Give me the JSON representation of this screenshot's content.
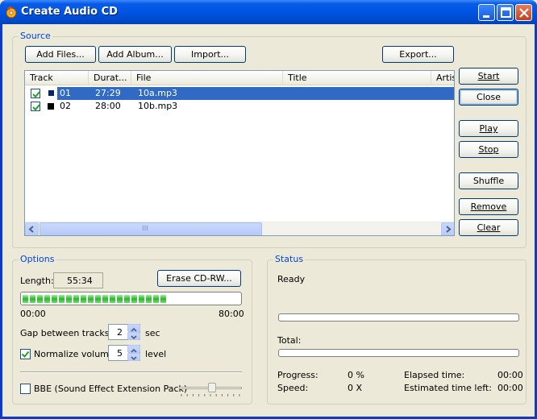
{
  "window": {
    "title": "Create Audio CD"
  },
  "source": {
    "group_label": "Source",
    "buttons": {
      "add_files": "Add Files...",
      "add_album": "Add Album...",
      "import": "Import...",
      "export": "Export..."
    },
    "columns": [
      "Track",
      "Durat...",
      "File",
      "Title",
      "Artis"
    ],
    "tracks": [
      {
        "checked": true,
        "track": "01",
        "duration": "27:29",
        "file": "10a.mp3",
        "selected": true
      },
      {
        "checked": true,
        "track": "02",
        "duration": "28:00",
        "file": "10b.mp3",
        "selected": false
      }
    ],
    "scroll_grip": "III"
  },
  "side_buttons": {
    "start": "Start",
    "close": "Close",
    "play": "Play",
    "stop": "Stop",
    "shuffle": "Shuffle",
    "remove": "Remove",
    "clear": "Clear"
  },
  "options": {
    "group_label": "Options",
    "length_label": "Length:",
    "length_value": "55:34",
    "erase_button": "Erase CD-RW...",
    "capacity_fill_fraction": 0.69,
    "scale_start": "00:00",
    "scale_end": "80:00",
    "gap_label": "Gap between tracks:",
    "gap_value": "2",
    "gap_unit": "sec",
    "normalize_label": "Normalize volume:",
    "normalize_checked": true,
    "normalize_value": "5",
    "normalize_unit": "level",
    "bbe_label": "BBE (Sound Effect Extension Pack)",
    "bbe_checked": false
  },
  "status": {
    "group_label": "Status",
    "state": "Ready",
    "total_label": "Total:",
    "progress_label": "Progress:",
    "progress_value": "0 %",
    "speed_label": "Speed:",
    "speed_value": "0 X",
    "elapsed_label": "Elapsed time:",
    "elapsed_value": "00:00",
    "estimated_label": "Estimated time left:",
    "estimated_value": "00:00"
  },
  "colors": {
    "accent": "#0046d5",
    "selection": "#316ac5",
    "progress_green": "#2cb52c"
  }
}
